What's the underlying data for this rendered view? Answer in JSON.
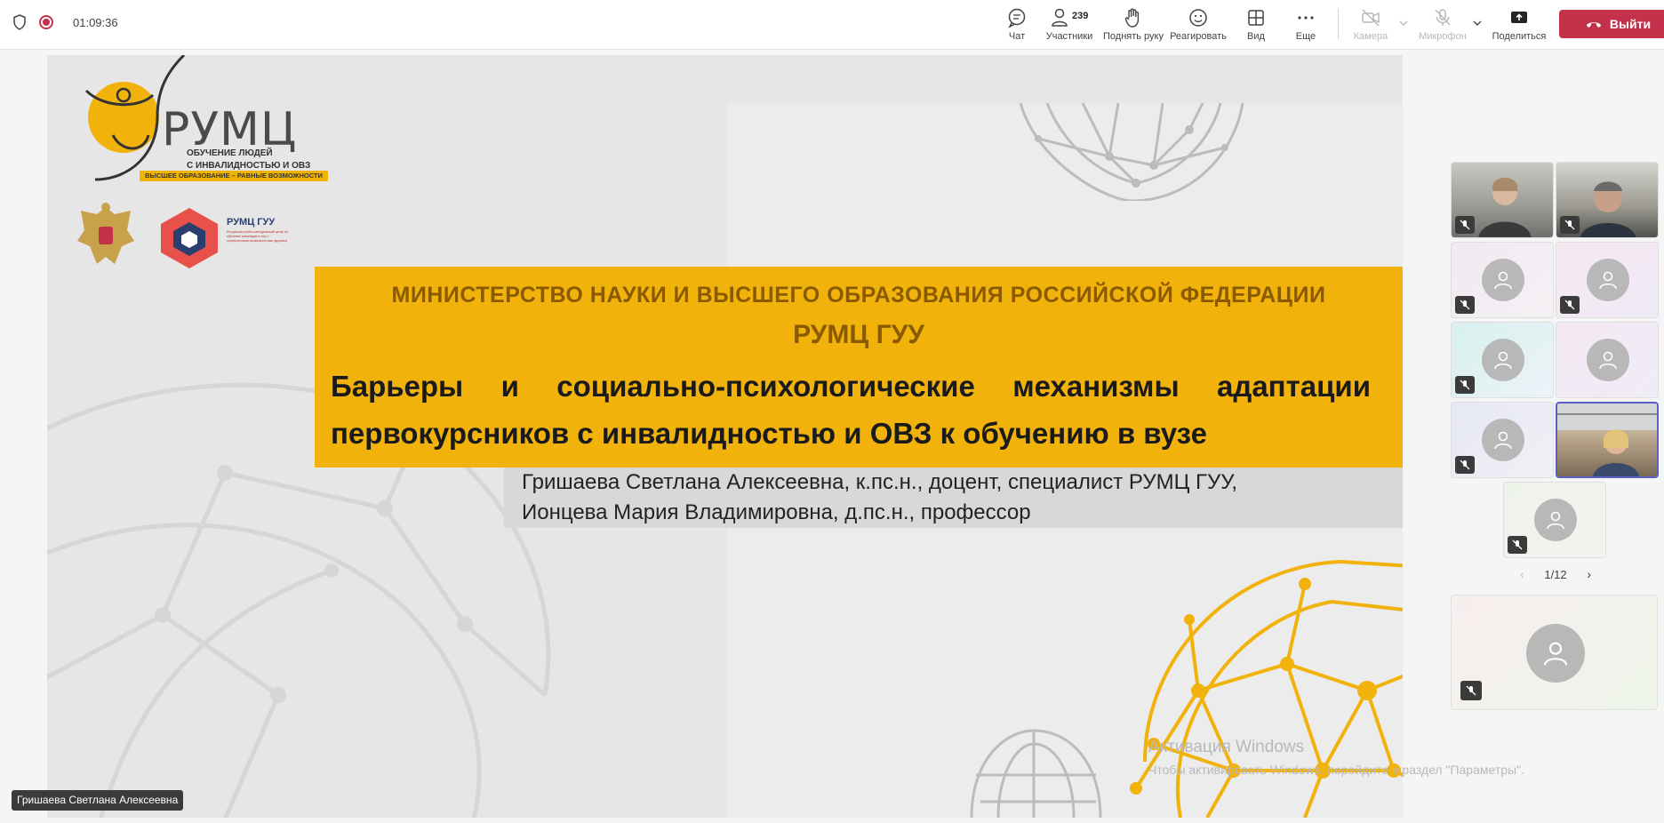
{
  "meeting": {
    "timer": "01:09:36"
  },
  "toolbar": {
    "chat_label": "Чат",
    "participants_label": "Участники",
    "participants_count": "239",
    "raise_hand_label": "Поднять руку",
    "react_label": "Реагировать",
    "view_label": "Вид",
    "more_label": "Еще",
    "camera_label": "Камера",
    "mic_label": "Микрофон",
    "share_label": "Поделиться",
    "leave_label": "Выйти"
  },
  "slide": {
    "logo_text": "РУМЦ",
    "logo_subtitle_line1": "ОБУЧЕНИЕ ЛЮДЕЙ",
    "logo_subtitle_line2": "С ИНВАЛИДНОСТЬЮ И ОВЗ",
    "logo_tagline": "ВЫСШЕЕ ОБРАЗОВАНИЕ – РАВНЫЕ ВОЗМОЖНОСТИ",
    "guu_logo_text": "РУМЦ ГУУ",
    "guu_logo_small": "Ресурсный учебно-методический центр по обучению инвалидов и лиц с ограниченными возможностями здоровья",
    "ministry": "МИНИСТЕРСТВО НАУКИ И ВЫСШЕГО ОБРАЗОВАНИЯ РОССИЙСКОЙ ФЕДЕРАЦИИ",
    "org": "РУМЦ ГУУ",
    "title": "Барьеры и социально-психологические механизмы  адаптации первокурсников с  инвалидностью и ОВЗ к обучению в вузе",
    "author1": "Гришаева Светлана Алексеевна, к.пс.н., доцент, специалист РУМЦ ГУУ,",
    "author2": "Ионцева Мария Владимировна, д.пс.н., профессор"
  },
  "windows_watermark": {
    "line1": "Активация Windows",
    "line2": "Чтобы активировать Windows, перейдите в раздел \"Параметры\"."
  },
  "presenter_name": "Гришаева Светлана Алексеевна",
  "gallery": {
    "page_indicator": "1/12"
  },
  "colors": {
    "banner": "#f1b20c",
    "leave_button": "#c4314b",
    "active_speaker_border": "#5b5fc7"
  }
}
